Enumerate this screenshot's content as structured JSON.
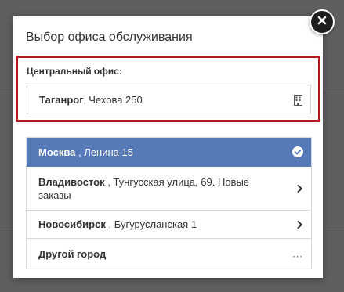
{
  "dialog": {
    "title": "Выбор офиса обслуживания",
    "close_icon": "close-icon"
  },
  "central_office": {
    "label": "Центральный офис:",
    "city": "Таганрог",
    "separator": " ,",
    "address": "Чехова 250",
    "icon": "building-icon",
    "highlight_color": "#b3161d"
  },
  "offices": [
    {
      "city": "Москва",
      "separator": " ,",
      "address": "Ленина 15",
      "selected": true,
      "icon": "check-circle-icon"
    },
    {
      "city": "Владивосток",
      "separator": " ,",
      "address": "Тунгусская улица, 69. Новые заказы",
      "selected": false,
      "icon": "chevron-right-icon"
    },
    {
      "city": "Новосибирск",
      "separator": " ,",
      "address": "Бугурусланская 1",
      "selected": false,
      "icon": "chevron-right-icon"
    },
    {
      "city": "Другой город",
      "separator": "",
      "address": "",
      "selected": false,
      "icon": "ellipsis-icon",
      "more": "..."
    }
  ],
  "colors": {
    "selected_bg": "#5679b8",
    "backdrop": "#5f5f5f"
  }
}
